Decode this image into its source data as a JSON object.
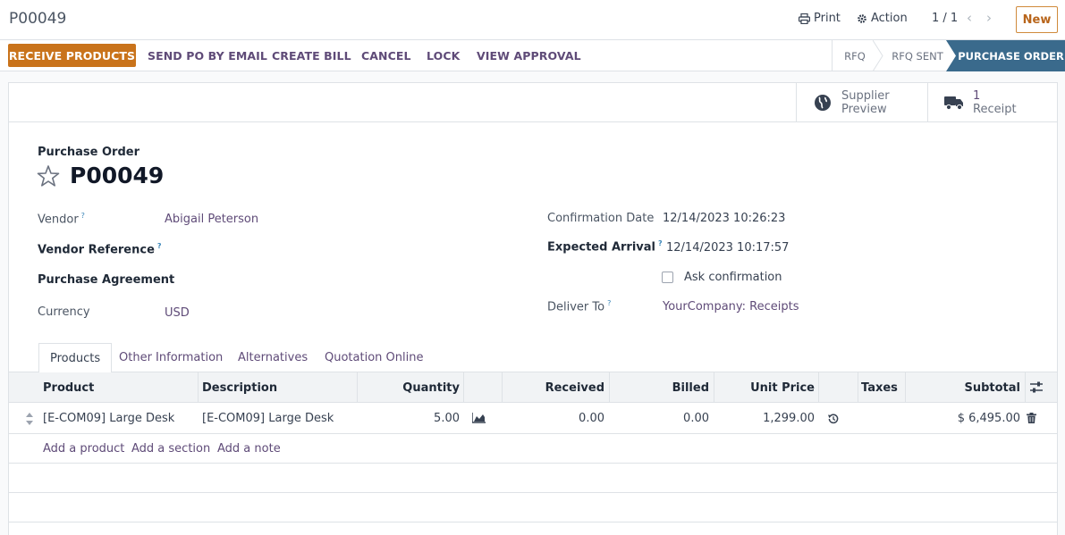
{
  "breadcrumb": "P00049",
  "toolbar": {
    "print_label": "Print",
    "action_label": "Action",
    "pager": "1 / 1",
    "new_label": "New"
  },
  "statusbar": {
    "buttons": [
      "RECEIVE PRODUCTS",
      "SEND PO BY EMAIL",
      "CREATE BILL",
      "CANCEL",
      "LOCK",
      "VIEW APPROVAL"
    ],
    "stages": [
      "RFQ",
      "RFQ SENT",
      "PURCHASE ORDER"
    ],
    "active_stage": "PURCHASE ORDER"
  },
  "smart_buttons": {
    "supplier_preview": {
      "line1": "Supplier",
      "line2": "Preview"
    },
    "receipt": {
      "count": "1",
      "label": "Receipt"
    }
  },
  "form": {
    "type_label": "Purchase Order",
    "name": "P00049",
    "left": {
      "vendor_label": "Vendor",
      "vendor_value": "Abigail Peterson",
      "vendor_ref_label": "Vendor Reference",
      "agreement_label": "Purchase Agreement",
      "currency_label": "Currency",
      "currency_value": "USD"
    },
    "right": {
      "confirmation_label": "Confirmation Date",
      "confirmation_value": "12/14/2023 10:26:23",
      "expected_label": "Expected Arrival",
      "expected_value": "12/14/2023 10:17:57",
      "ask_confirmation_label": "Ask confirmation",
      "deliver_to_label": "Deliver To",
      "deliver_to_value": "YourCompany: Receipts"
    },
    "help_mark": "?"
  },
  "tabs": [
    "Products",
    "Other Information",
    "Alternatives",
    "Quotation Online"
  ],
  "table": {
    "headers": {
      "product": "Product",
      "description": "Description",
      "quantity": "Quantity",
      "received": "Received",
      "billed": "Billed",
      "unit_price": "Unit Price",
      "taxes": "Taxes",
      "subtotal": "Subtotal"
    },
    "rows": [
      {
        "product": "[E-COM09] Large Desk",
        "description": "[E-COM09] Large Desk",
        "quantity": "5.00",
        "received": "0.00",
        "billed": "0.00",
        "unit_price": "1,299.00",
        "taxes": "",
        "subtotal": "$ 6,495.00"
      }
    ],
    "add_links": [
      "Add a product",
      "Add a section",
      "Add a note"
    ]
  },
  "colors": {
    "primary_button": "#c9731b",
    "active_stage": "#3a6a8c",
    "link": "#5f4b78"
  }
}
